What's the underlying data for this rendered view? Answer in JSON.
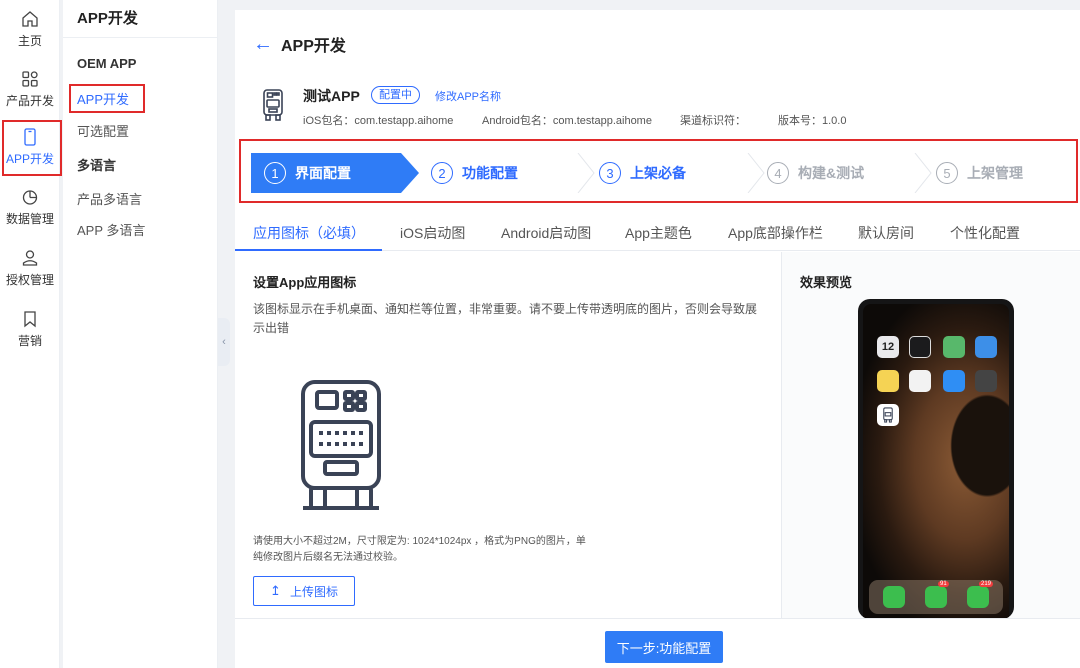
{
  "rail": {
    "items": [
      {
        "label": "主页",
        "icon": "home-icon"
      },
      {
        "label": "产品开发",
        "icon": "grid-icon"
      },
      {
        "label": "APP开发",
        "icon": "phone-icon"
      },
      {
        "label": "数据管理",
        "icon": "pie-chart-icon"
      },
      {
        "label": "授权管理",
        "icon": "user-icon"
      },
      {
        "label": "营销",
        "icon": "bookmark-icon"
      }
    ],
    "active_index": 2
  },
  "submenu": {
    "title": "APP开发",
    "group1": "OEM APP",
    "item_app": "APP开发",
    "item_optional": "可选配置",
    "group2": "多语言",
    "item_product_lang": "产品多语言",
    "item_app_lang": "APP 多语言"
  },
  "header": {
    "title": "APP开发"
  },
  "app": {
    "name": "测试APP",
    "status": "配置中",
    "rename": "修改APP名称",
    "ios_package": "iOS包名：com.testapp.aihome",
    "android_package": "Android包名：com.testapp.aihome",
    "channel": "渠道标识符：",
    "version": "版本号：1.0.0"
  },
  "steps": [
    {
      "num": "1",
      "label": "界面配置",
      "state": "active"
    },
    {
      "num": "2",
      "label": "功能配置",
      "state": "pending"
    },
    {
      "num": "3",
      "label": "上架必备",
      "state": "pending"
    },
    {
      "num": "4",
      "label": "构建&测试",
      "state": "disabled"
    },
    {
      "num": "5",
      "label": "上架管理",
      "state": "disabled"
    }
  ],
  "tabs": [
    "应用图标（必填）",
    "iOS启动图",
    "Android启动图",
    "App主题色",
    "App底部操作栏",
    "默认房间",
    "个性化配置"
  ],
  "content": {
    "section_title": "设置App应用图标",
    "description": "该图标显示在手机桌面、通知栏等位置，非常重要。请不要上传带透明底的图片，否则会导致展示出错",
    "hint_line1": "请使用大小不超过2M，尺寸限定为: 1024*1024px ，格式为PNG的图片，单",
    "hint_line2": "纯修改图片后缀名无法通过校验。",
    "upload_label": "上传图标"
  },
  "preview": {
    "title": "效果预览",
    "phone_time": "12",
    "badge_1": "91",
    "badge_2": "219"
  },
  "footer": {
    "next_label": "下一步:功能配置"
  },
  "colors": {
    "accent": "#2f7cf6",
    "highlight": "#e02a2a",
    "disabled": "#a8adb5"
  }
}
